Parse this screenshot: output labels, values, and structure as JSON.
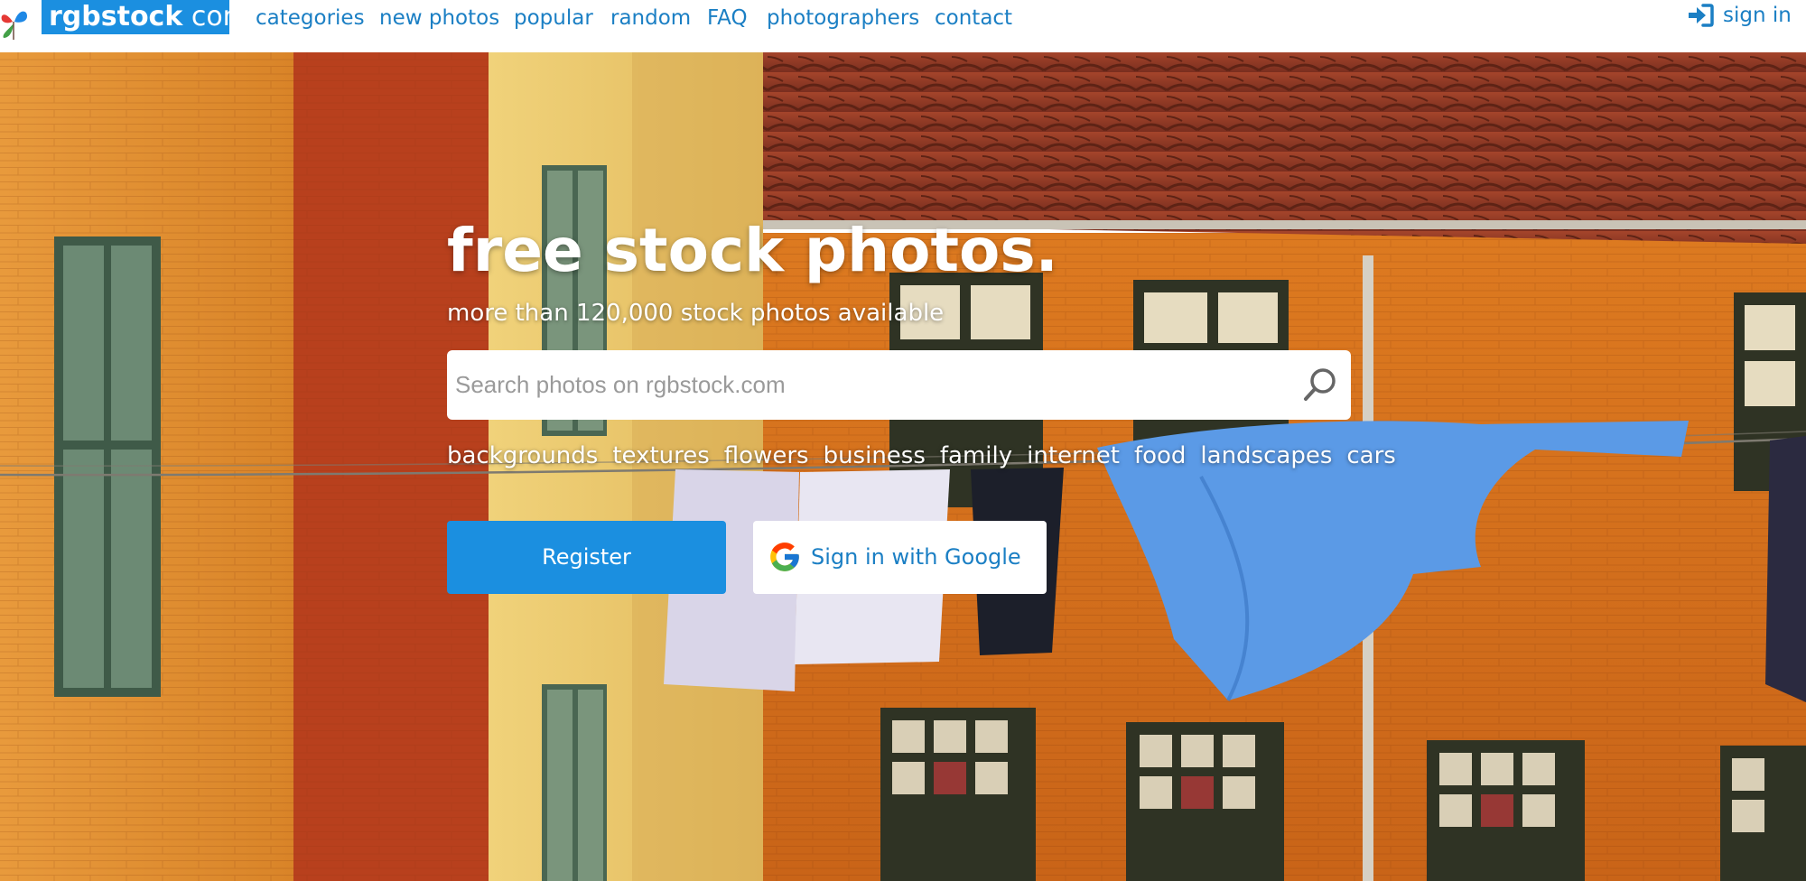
{
  "brand": {
    "name_bold": "rgbstock",
    "name_rest": " com",
    "accent_color": "#1b8fe0",
    "link_color": "#1b7fc4"
  },
  "nav": {
    "links": [
      "categories",
      "new photos",
      "popular",
      "random",
      "FAQ",
      "photographers",
      "contact"
    ],
    "signin_label": "sign in",
    "signin_icon": "sign-in-icon"
  },
  "hero": {
    "headline": "free stock photos.",
    "subline": "more than 120,000 stock photos available",
    "search": {
      "placeholder": "Search photos on rgbstock.com",
      "value": "",
      "icon": "search-icon"
    },
    "tags": [
      "backgrounds",
      "textures",
      "flowers",
      "business",
      "family",
      "internet",
      "food",
      "landscapes",
      "cars"
    ],
    "register_label": "Register",
    "google_label": "Sign in with Google",
    "google_icon": "google-logo-icon"
  }
}
